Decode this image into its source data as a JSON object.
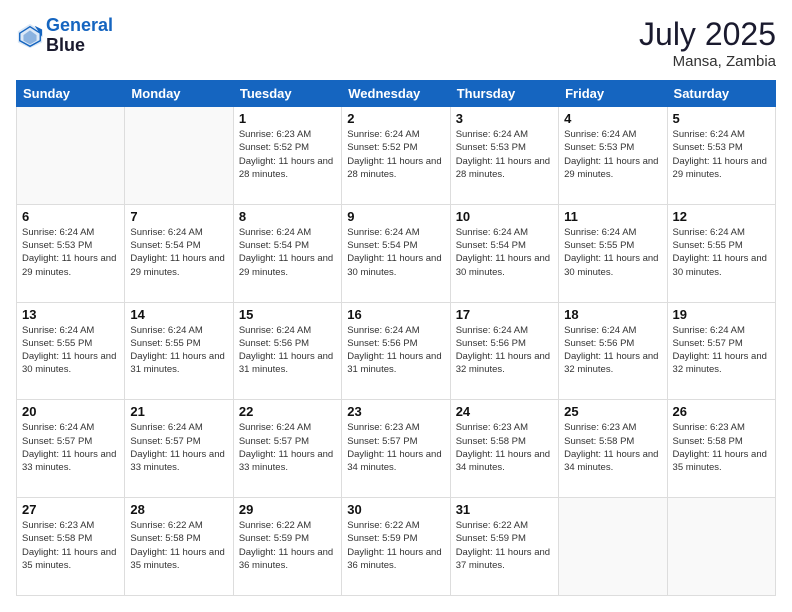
{
  "header": {
    "logo_line1": "General",
    "logo_line2": "Blue",
    "month": "July 2025",
    "location": "Mansa, Zambia"
  },
  "days_of_week": [
    "Sunday",
    "Monday",
    "Tuesday",
    "Wednesday",
    "Thursday",
    "Friday",
    "Saturday"
  ],
  "weeks": [
    [
      {
        "day": "",
        "info": ""
      },
      {
        "day": "",
        "info": ""
      },
      {
        "day": "1",
        "info": "Sunrise: 6:23 AM\nSunset: 5:52 PM\nDaylight: 11 hours and 28 minutes."
      },
      {
        "day": "2",
        "info": "Sunrise: 6:24 AM\nSunset: 5:52 PM\nDaylight: 11 hours and 28 minutes."
      },
      {
        "day": "3",
        "info": "Sunrise: 6:24 AM\nSunset: 5:53 PM\nDaylight: 11 hours and 28 minutes."
      },
      {
        "day": "4",
        "info": "Sunrise: 6:24 AM\nSunset: 5:53 PM\nDaylight: 11 hours and 29 minutes."
      },
      {
        "day": "5",
        "info": "Sunrise: 6:24 AM\nSunset: 5:53 PM\nDaylight: 11 hours and 29 minutes."
      }
    ],
    [
      {
        "day": "6",
        "info": "Sunrise: 6:24 AM\nSunset: 5:53 PM\nDaylight: 11 hours and 29 minutes."
      },
      {
        "day": "7",
        "info": "Sunrise: 6:24 AM\nSunset: 5:54 PM\nDaylight: 11 hours and 29 minutes."
      },
      {
        "day": "8",
        "info": "Sunrise: 6:24 AM\nSunset: 5:54 PM\nDaylight: 11 hours and 29 minutes."
      },
      {
        "day": "9",
        "info": "Sunrise: 6:24 AM\nSunset: 5:54 PM\nDaylight: 11 hours and 30 minutes."
      },
      {
        "day": "10",
        "info": "Sunrise: 6:24 AM\nSunset: 5:54 PM\nDaylight: 11 hours and 30 minutes."
      },
      {
        "day": "11",
        "info": "Sunrise: 6:24 AM\nSunset: 5:55 PM\nDaylight: 11 hours and 30 minutes."
      },
      {
        "day": "12",
        "info": "Sunrise: 6:24 AM\nSunset: 5:55 PM\nDaylight: 11 hours and 30 minutes."
      }
    ],
    [
      {
        "day": "13",
        "info": "Sunrise: 6:24 AM\nSunset: 5:55 PM\nDaylight: 11 hours and 30 minutes."
      },
      {
        "day": "14",
        "info": "Sunrise: 6:24 AM\nSunset: 5:55 PM\nDaylight: 11 hours and 31 minutes."
      },
      {
        "day": "15",
        "info": "Sunrise: 6:24 AM\nSunset: 5:56 PM\nDaylight: 11 hours and 31 minutes."
      },
      {
        "day": "16",
        "info": "Sunrise: 6:24 AM\nSunset: 5:56 PM\nDaylight: 11 hours and 31 minutes."
      },
      {
        "day": "17",
        "info": "Sunrise: 6:24 AM\nSunset: 5:56 PM\nDaylight: 11 hours and 32 minutes."
      },
      {
        "day": "18",
        "info": "Sunrise: 6:24 AM\nSunset: 5:56 PM\nDaylight: 11 hours and 32 minutes."
      },
      {
        "day": "19",
        "info": "Sunrise: 6:24 AM\nSunset: 5:57 PM\nDaylight: 11 hours and 32 minutes."
      }
    ],
    [
      {
        "day": "20",
        "info": "Sunrise: 6:24 AM\nSunset: 5:57 PM\nDaylight: 11 hours and 33 minutes."
      },
      {
        "day": "21",
        "info": "Sunrise: 6:24 AM\nSunset: 5:57 PM\nDaylight: 11 hours and 33 minutes."
      },
      {
        "day": "22",
        "info": "Sunrise: 6:24 AM\nSunset: 5:57 PM\nDaylight: 11 hours and 33 minutes."
      },
      {
        "day": "23",
        "info": "Sunrise: 6:23 AM\nSunset: 5:57 PM\nDaylight: 11 hours and 34 minutes."
      },
      {
        "day": "24",
        "info": "Sunrise: 6:23 AM\nSunset: 5:58 PM\nDaylight: 11 hours and 34 minutes."
      },
      {
        "day": "25",
        "info": "Sunrise: 6:23 AM\nSunset: 5:58 PM\nDaylight: 11 hours and 34 minutes."
      },
      {
        "day": "26",
        "info": "Sunrise: 6:23 AM\nSunset: 5:58 PM\nDaylight: 11 hours and 35 minutes."
      }
    ],
    [
      {
        "day": "27",
        "info": "Sunrise: 6:23 AM\nSunset: 5:58 PM\nDaylight: 11 hours and 35 minutes."
      },
      {
        "day": "28",
        "info": "Sunrise: 6:22 AM\nSunset: 5:58 PM\nDaylight: 11 hours and 35 minutes."
      },
      {
        "day": "29",
        "info": "Sunrise: 6:22 AM\nSunset: 5:59 PM\nDaylight: 11 hours and 36 minutes."
      },
      {
        "day": "30",
        "info": "Sunrise: 6:22 AM\nSunset: 5:59 PM\nDaylight: 11 hours and 36 minutes."
      },
      {
        "day": "31",
        "info": "Sunrise: 6:22 AM\nSunset: 5:59 PM\nDaylight: 11 hours and 37 minutes."
      },
      {
        "day": "",
        "info": ""
      },
      {
        "day": "",
        "info": ""
      }
    ]
  ]
}
